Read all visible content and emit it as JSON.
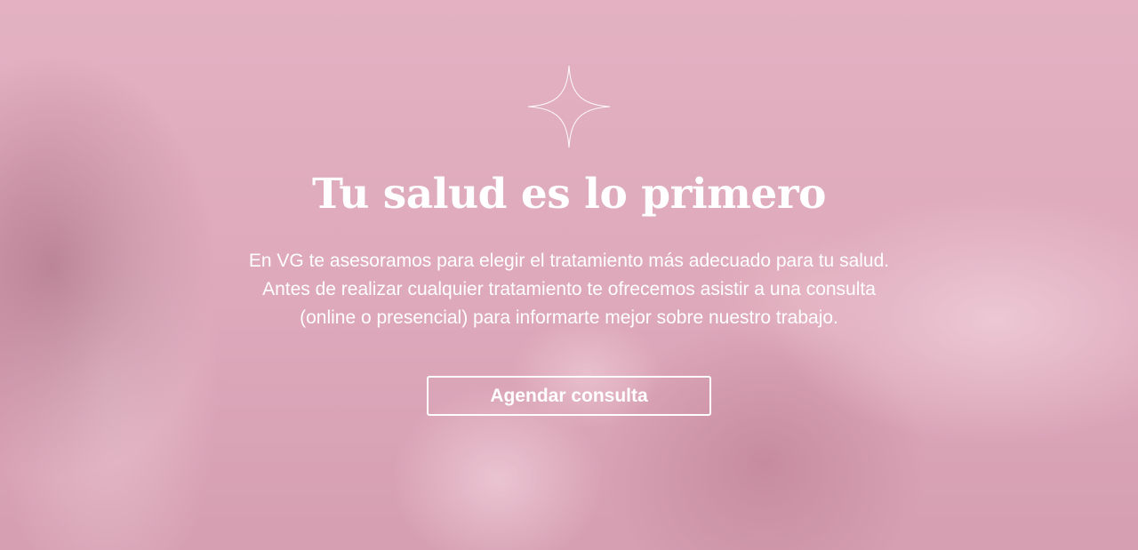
{
  "hero": {
    "icon": "sparkle-star-icon",
    "title": "Tu salud es lo primero",
    "description_lines": [
      "En VG te asesoramos para elegir el tratamiento más adecuado para tu salud.",
      "Antes de realizar cualquier tratamiento te ofrecemos asistir a una consulta",
      "(online o presencial) para informarte mejor sobre nuestro trabajo."
    ],
    "cta_label": "Agendar consulta",
    "overlay_color": "#e2a8bc",
    "text_color": "#ffffff"
  }
}
